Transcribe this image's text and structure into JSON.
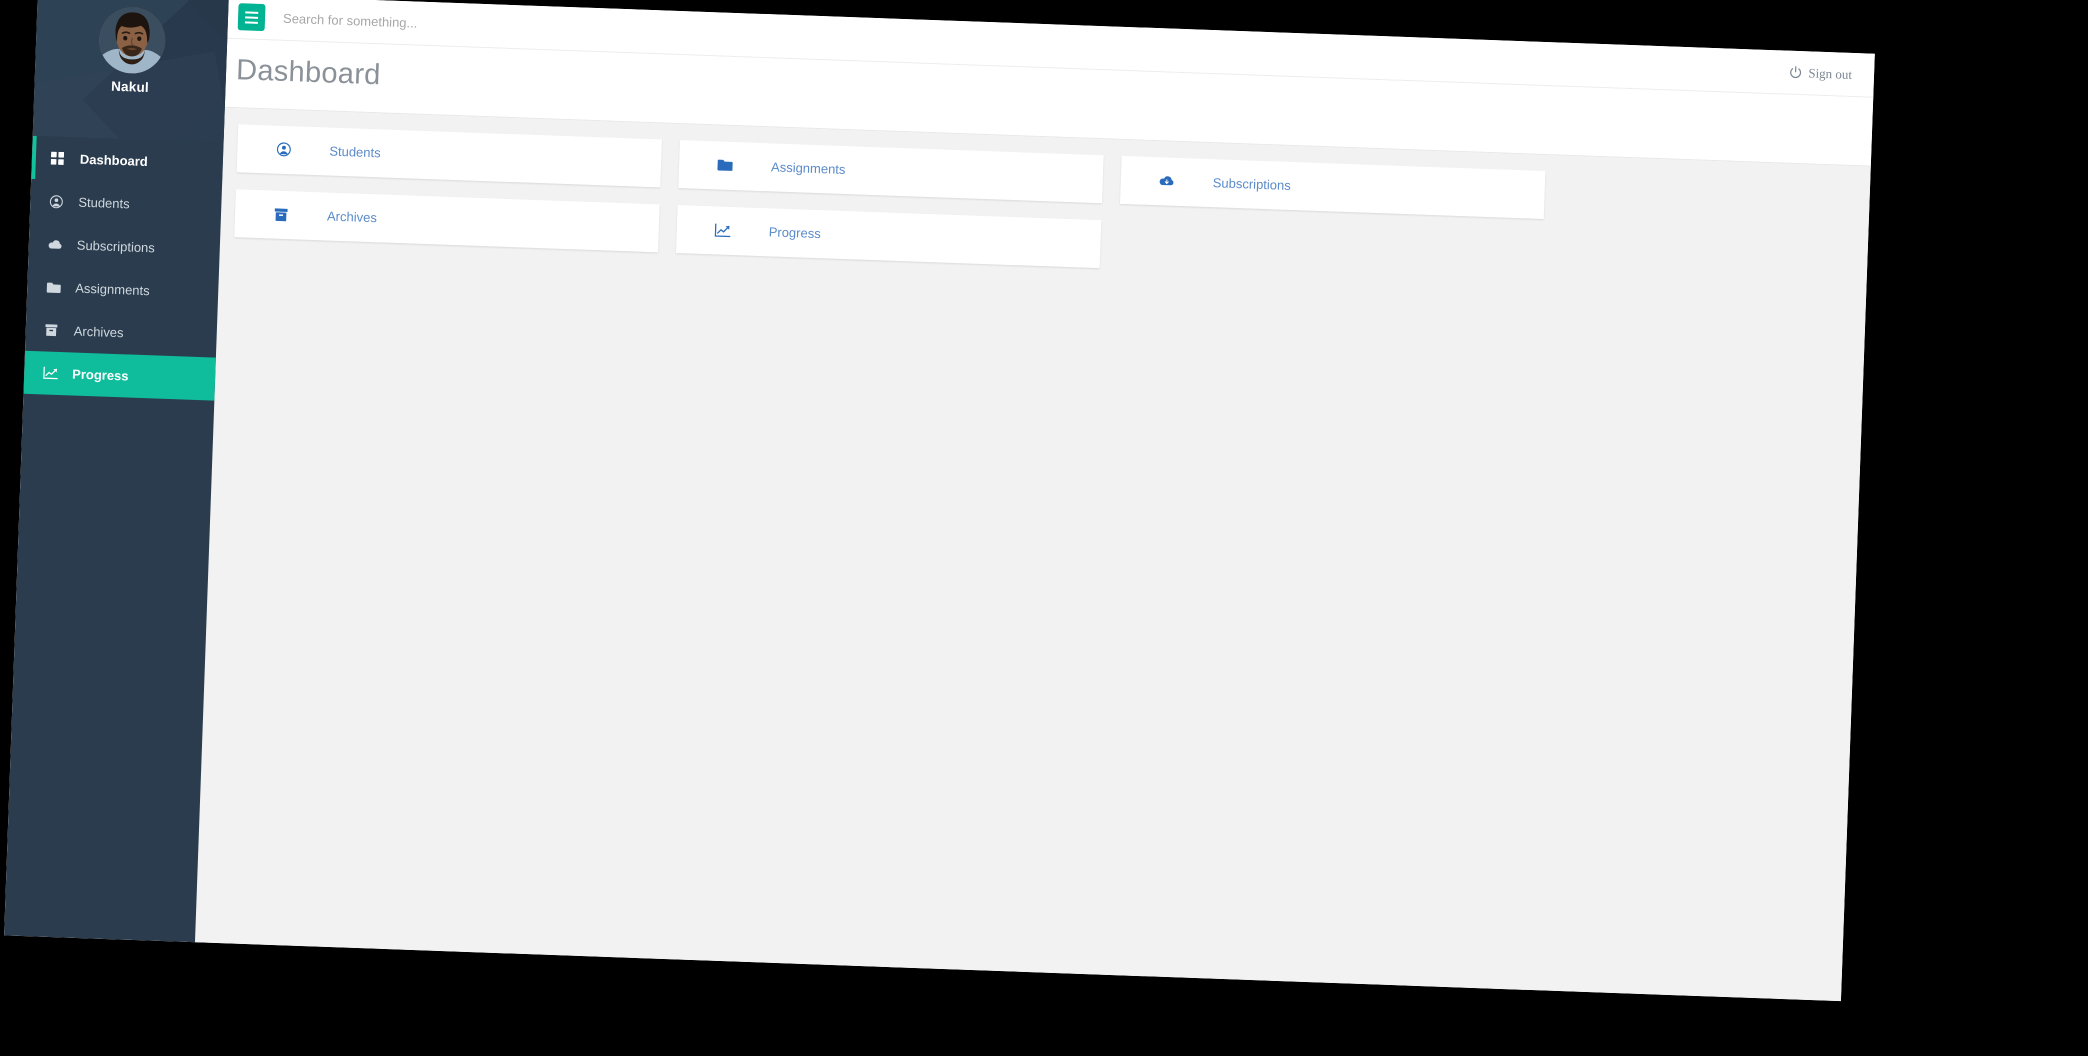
{
  "sidebar": {
    "profile": {
      "name": "Nakul",
      "avatar_icon": "user-photo-avatar"
    },
    "items": [
      {
        "label": "Dashboard",
        "icon": "grid-icon",
        "state": "active"
      },
      {
        "label": "Students",
        "icon": "user-circle-icon",
        "state": "normal"
      },
      {
        "label": "Subscriptions",
        "icon": "cloud-icon",
        "state": "normal"
      },
      {
        "label": "Assignments",
        "icon": "folder-icon",
        "state": "normal"
      },
      {
        "label": "Archives",
        "icon": "archive-icon",
        "state": "normal"
      },
      {
        "label": "Progress",
        "icon": "chart-line-icon",
        "state": "highlight"
      }
    ]
  },
  "topbar": {
    "menu_toggle_icon": "hamburger-icon",
    "search_placeholder": "Search for something...",
    "search_value": "",
    "signout_label": "Sign out",
    "signout_icon": "power-icon"
  },
  "page": {
    "title": "Dashboard"
  },
  "cards": [
    {
      "label": "Students",
      "icon": "user-circle-icon"
    },
    {
      "label": "Assignments",
      "icon": "folder-icon"
    },
    {
      "label": "Subscriptions",
      "icon": "cloud-download-icon"
    },
    {
      "label": "Archives",
      "icon": "archive-icon"
    },
    {
      "label": "Progress",
      "icon": "chart-line-icon"
    }
  ],
  "colors": {
    "sidebar_bg": "#2b3c4e",
    "accent_teal": "#0fbd9d",
    "content_bg": "#f2f2f2",
    "card_label_blue": "#5b8bc9",
    "card_icon_blue": "#2a6cbb",
    "title_grey": "#8a9198",
    "backdrop": "#000000"
  }
}
